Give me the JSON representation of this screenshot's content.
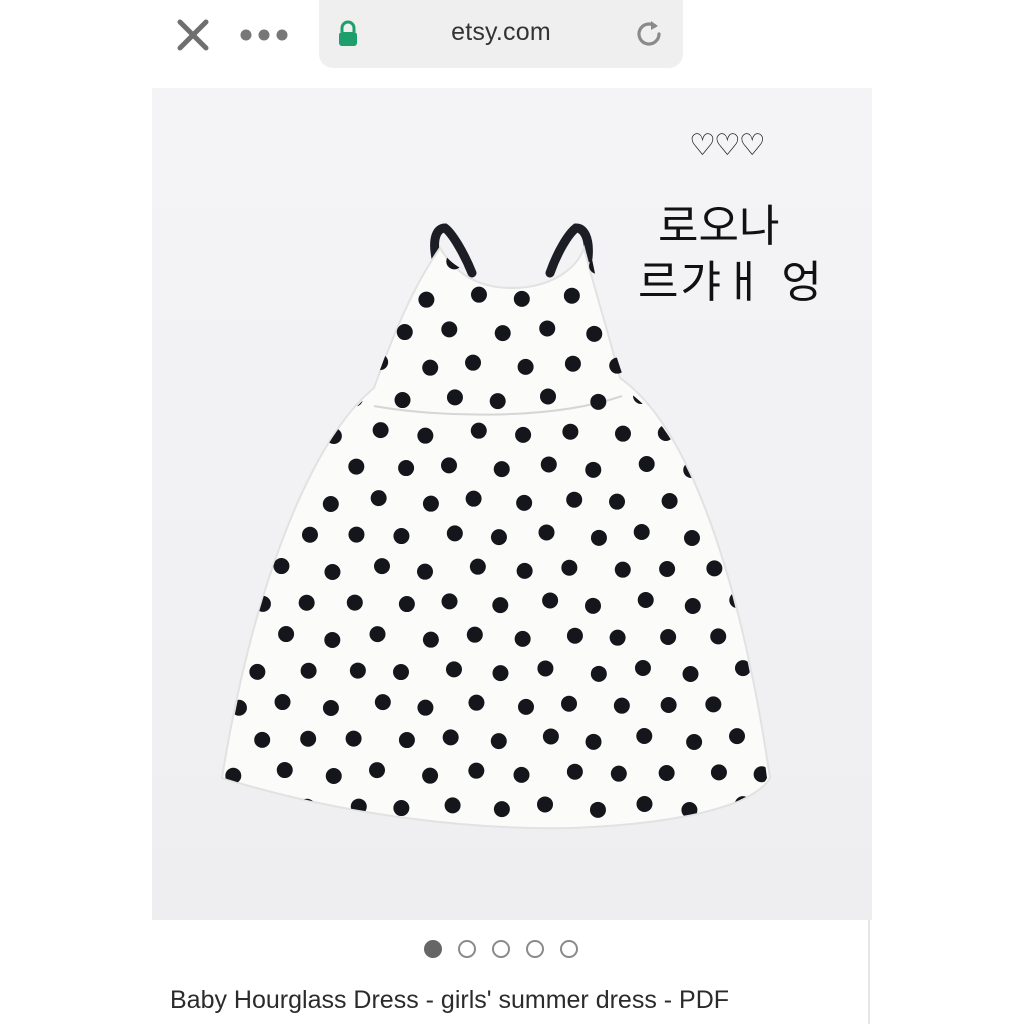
{
  "browser": {
    "url": "etsy.com",
    "close_icon": "close-icon",
    "more_icon": "more-dots-icon",
    "lock_icon": "lock-icon",
    "reload_icon": "reload-icon",
    "lock_color": "#1e9e6a"
  },
  "listing": {
    "overlay_hearts": "♡♡♡",
    "overlay_line1": "로오나",
    "overlay_line2": "르갸ㅐ 엉",
    "carousel": {
      "total": 5,
      "active_index": 0
    },
    "title": "Baby Hourglass Dress - girls' summer dress - PDF"
  }
}
